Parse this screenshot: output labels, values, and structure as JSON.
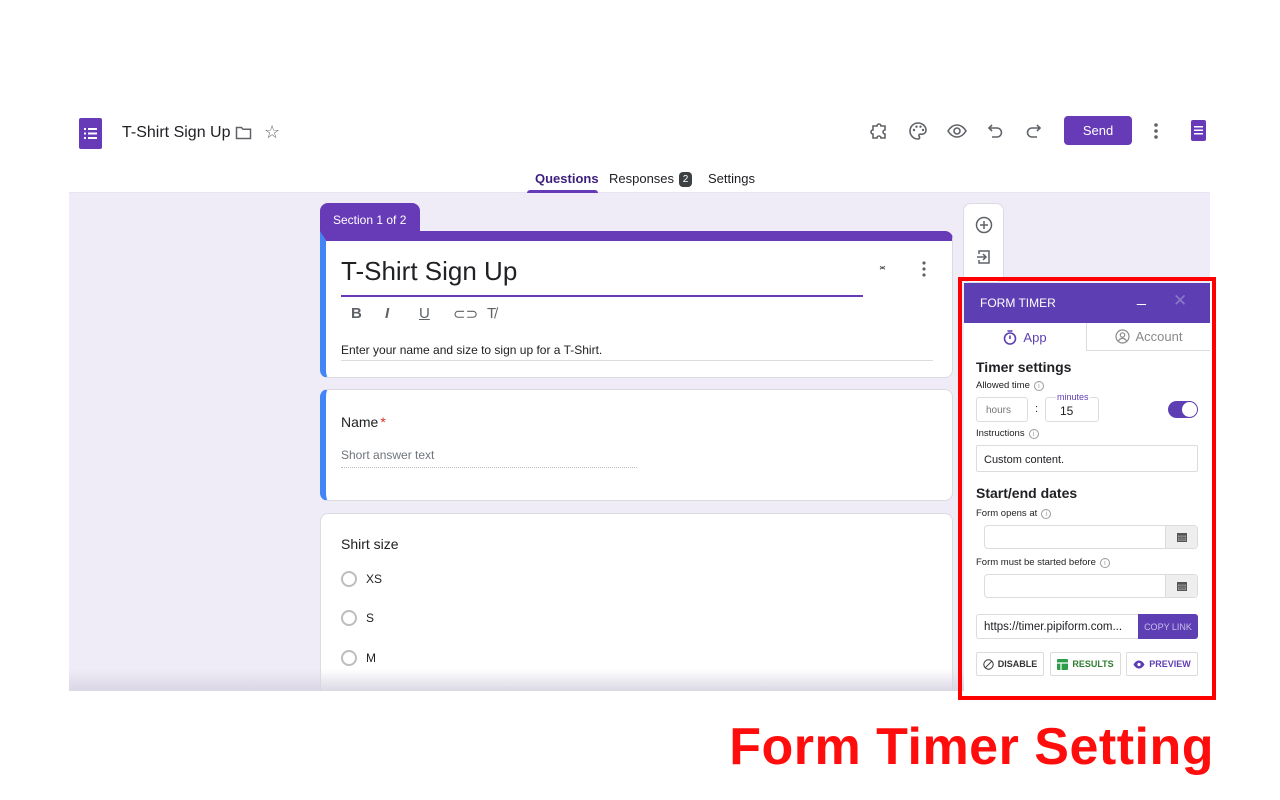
{
  "header": {
    "doc_title": "T-Shirt Sign Up",
    "send_label": "Send",
    "icons": [
      "addons-icon",
      "palette-icon",
      "preview-icon",
      "undo-icon",
      "redo-icon",
      "more-vert-icon",
      "sheets-icon"
    ]
  },
  "tabs": {
    "questions": "Questions",
    "responses": "Responses",
    "responses_count": "2",
    "settings": "Settings"
  },
  "form": {
    "section_label": "Section 1 of 2",
    "title": "T-Shirt Sign Up",
    "format_buttons": [
      "B",
      "I",
      "U",
      "link",
      "clear"
    ],
    "description": "Enter your name and size to sign up for a T-Shirt.",
    "questions": [
      {
        "label": "Name",
        "required": "*",
        "placeholder": "Short answer text"
      },
      {
        "label": "Shirt size",
        "options": [
          "XS",
          "S",
          "M"
        ]
      }
    ]
  },
  "form_timer": {
    "title": "FORM TIMER",
    "minimize": "_",
    "close": "✕",
    "tabs": {
      "app": "App",
      "account": "Account"
    },
    "timer_settings_heading": "Timer settings",
    "allowed_time_label": "Allowed time",
    "hours_placeholder": "hours",
    "colon": ":",
    "minutes_label": "minutes",
    "minutes_value": "15",
    "timer_enabled": true,
    "instructions_label": "Instructions",
    "instructions_value": "Custom content.",
    "dates_heading": "Start/end dates",
    "opens_at_label": "Form opens at",
    "opens_at_value": "",
    "started_before_label": "Form must be started before",
    "started_before_value": "",
    "link_value": "https://timer.pipiform.com...",
    "copy_link_label": "COPY LINK",
    "disable_label": "DISABLE",
    "results_label": "RESULTS",
    "preview_label": "PREVIEW",
    "colors": {
      "accent": "#5e3fb3",
      "results": "#2e7d32",
      "highlight": "#ff0000"
    }
  },
  "caption": "Form Timer Setting"
}
